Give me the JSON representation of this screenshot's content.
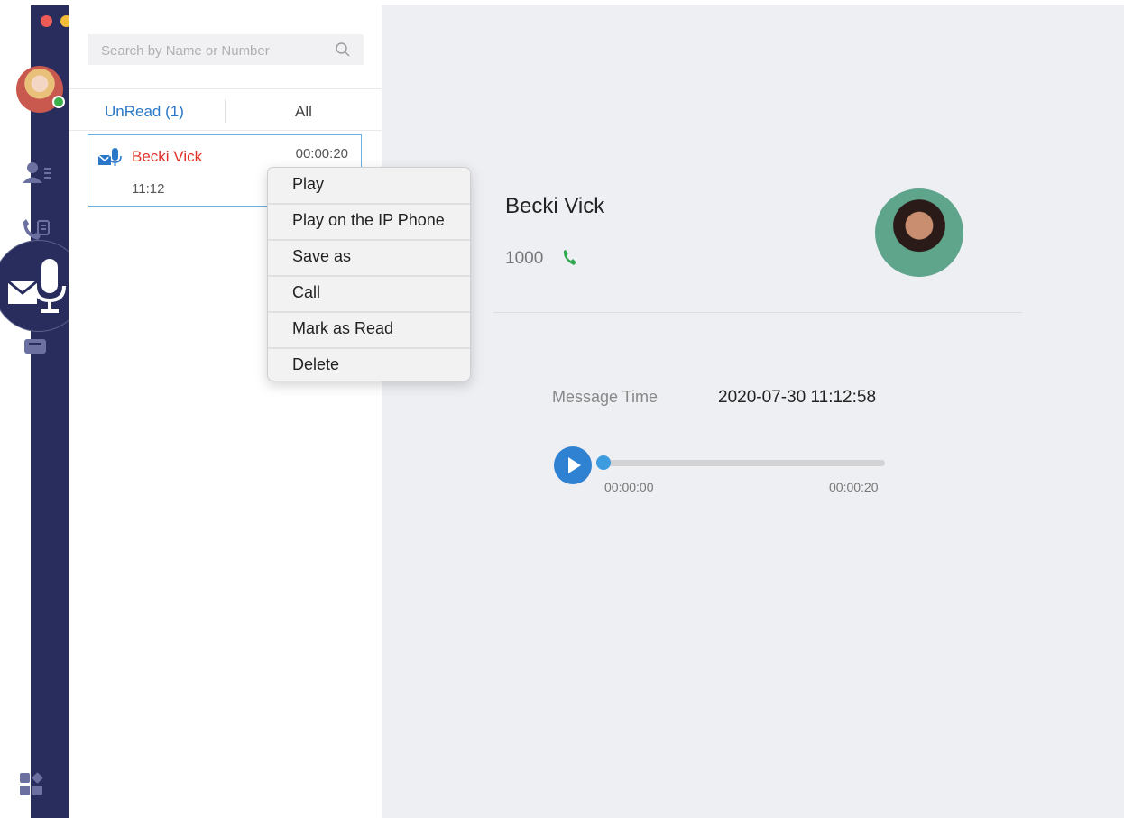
{
  "search": {
    "placeholder": "Search by Name or Number"
  },
  "tabs": {
    "unread": "UnRead (1)",
    "all": "All"
  },
  "voicemail_list": [
    {
      "name": "Becki Vick",
      "duration": "00:00:20",
      "time": "11:12"
    }
  ],
  "context_menu": {
    "items": [
      "Play",
      "Play on the IP Phone",
      "Save as",
      "Call",
      "Mark as Read",
      "Delete"
    ]
  },
  "detail": {
    "name": "Becki Vick",
    "number": "1000",
    "message_time_label": "Message Time",
    "message_time_value": "2020-07-30 11:12:58",
    "player": {
      "current": "00:00:00",
      "total": "00:00:20",
      "progress": 0
    }
  },
  "icons": {
    "contacts": "contacts-icon",
    "call_history": "call-history-icon",
    "voicemail": "voicemail-icon",
    "fax": "fax-icon",
    "apps": "apps-icon",
    "search": "search-icon",
    "phone": "phone-icon",
    "play": "play-icon"
  },
  "colors": {
    "sidebar": "#282d5e",
    "accent": "#2b78c8",
    "unread_name": "#e0332b",
    "call_green": "#2fa84f"
  }
}
